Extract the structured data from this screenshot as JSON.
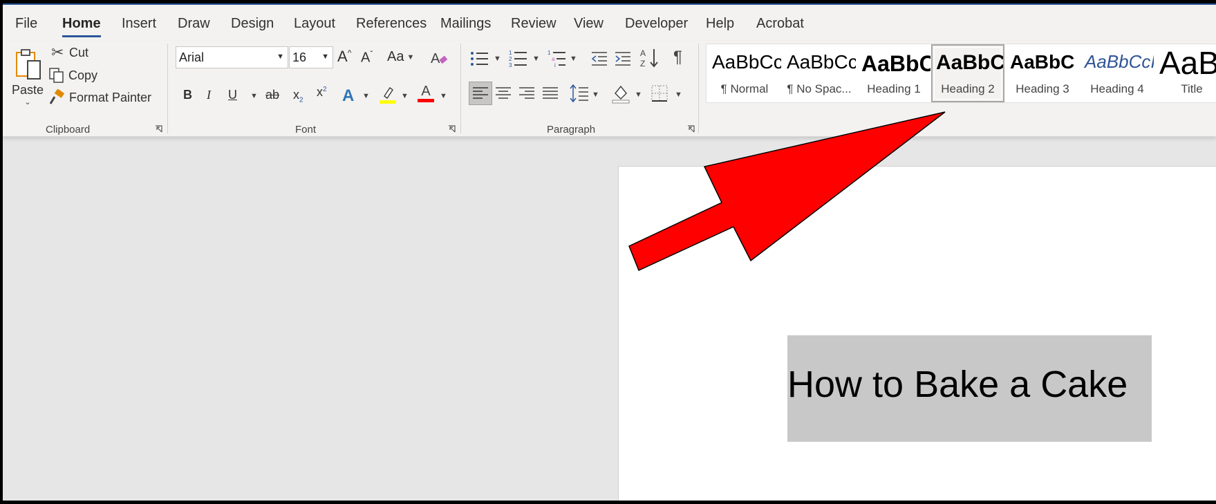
{
  "tabs": [
    "File",
    "Home",
    "Insert",
    "Draw",
    "Design",
    "Layout",
    "References",
    "Mailings",
    "Review",
    "View",
    "Developer",
    "Help",
    "Acrobat"
  ],
  "active_tab": "Home",
  "clipboard": {
    "paste_label": "Paste",
    "cut_label": "Cut",
    "copy_label": "Copy",
    "format_painter_label": "Format Painter",
    "group_label": "Clipboard"
  },
  "font": {
    "name": "Arial",
    "size": "16",
    "group_label": "Font",
    "bold": "B",
    "italic": "I",
    "underline": "U",
    "strikethrough": "ab",
    "subscript": "x",
    "superscript": "x",
    "change_case": "Aa",
    "text_effects": "A",
    "font_color": "A",
    "highlight_color": "#ffff00",
    "font_color_value": "#ff0000"
  },
  "paragraph": {
    "group_label": "Paragraph",
    "align_selected": "left",
    "pilcrow": "¶"
  },
  "styles": {
    "selected": "Heading 2",
    "items": [
      {
        "sample": "AaBbCcDc",
        "name": "¶ Normal"
      },
      {
        "sample": "AaBbCcDc",
        "name": "¶ No Spac..."
      },
      {
        "sample": "AaBbC(",
        "name": "Heading 1"
      },
      {
        "sample": "AaBbC(",
        "name": "Heading 2"
      },
      {
        "sample": "AaBbC",
        "name": "Heading 3"
      },
      {
        "sample": "AaBbCcI",
        "name": "Heading 4"
      },
      {
        "sample": "AaB",
        "name": "Title"
      }
    ]
  },
  "document": {
    "heading": "How to Bake a Cake",
    "highlight_color": "#c8c8c8"
  },
  "annotation": {
    "arrow_color": "#ff0000"
  }
}
